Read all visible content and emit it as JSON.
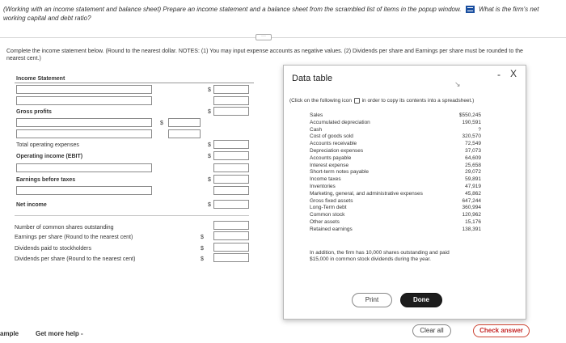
{
  "question": {
    "text_before": "(Working with an income statement and balance sheet) Prepare an income statement and a balance sheet from the scrambled list of items in the popup window.",
    "text_after": "What is the firm's net working capital and debt ratio?"
  },
  "instructions": "Complete the income statement below. (Round to the nearest dollar. NOTES: (1) You may input expense accounts as negative values. (2) Dividends per share and Earnings per share must be rounded to the nearest cent.)",
  "income_statement": {
    "title": "Income Statement",
    "currency": "$",
    "gross_profits": "Gross profits",
    "total_operating_expenses": "Total operating expenses",
    "operating_income": "Operating income (EBIT)",
    "earnings_before_taxes": "Earnings before taxes",
    "net_income": "Net income",
    "shares_outstanding": "Number of common shares outstanding",
    "eps": "Earnings per share (Round to the nearest cent)",
    "dividends_paid": "Dividends paid to stockholders",
    "dps": "Dividends per share (Round to the nearest cent)"
  },
  "modal": {
    "title": "Data table",
    "minimize": "-",
    "close": "X",
    "copy_note_before": "(Click on the following icon",
    "copy_note_after": "in order to copy its contents into a spreadsheet.)",
    "rows": [
      {
        "label": "Sales",
        "value": "$550,245"
      },
      {
        "label": "Accumulated depreciation",
        "value": "190,591"
      },
      {
        "label": "Cash",
        "value": "?"
      },
      {
        "label": "Cost of goods sold",
        "value": "320,570"
      },
      {
        "label": "Accounts receivable",
        "value": "72,549"
      },
      {
        "label": "Depreciation expenses",
        "value": "37,073"
      },
      {
        "label": "Accounts payable",
        "value": "64,609"
      },
      {
        "label": "Interest expense",
        "value": "25,658"
      },
      {
        "label": "Short-term notes payable",
        "value": "29,072"
      },
      {
        "label": "Income taxes",
        "value": "59,891"
      },
      {
        "label": "Inventories",
        "value": "47,919"
      },
      {
        "label": "Marketing, general, and administrative expenses",
        "value": "45,862"
      },
      {
        "label": "Gross fixed assets",
        "value": "647,244"
      },
      {
        "label": "Long-Term debt",
        "value": "360,994"
      },
      {
        "label": "Common stock",
        "value": "120,962"
      },
      {
        "label": "Other assets",
        "value": "15,176"
      },
      {
        "label": "Retained earnings",
        "value": "138,391"
      }
    ],
    "note_line1": "In addition, the firm has 10,000 shares outstanding and paid",
    "note_line2": "$15,000 in common stock dividends during the year.",
    "print_label": "Print",
    "done_label": "Done"
  },
  "footer": {
    "left_text": "ample",
    "help_label": "Get more help -",
    "clear_label": "Clear all",
    "check_label": "Check answer"
  }
}
